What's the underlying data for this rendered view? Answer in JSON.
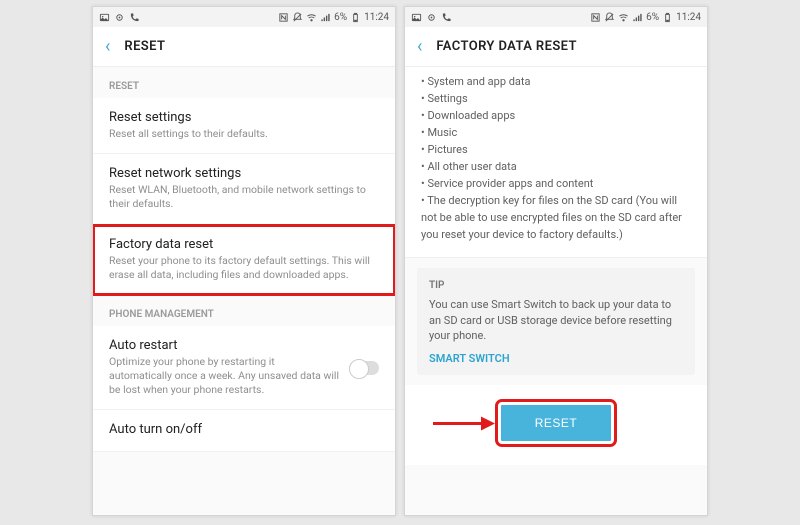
{
  "status": {
    "battery_pct": "6%",
    "time": "11:24"
  },
  "left": {
    "title": "RESET",
    "sections": {
      "reset_header": "RESET",
      "items": [
        {
          "primary": "Reset settings",
          "secondary": "Reset all settings to their defaults."
        },
        {
          "primary": "Reset network settings",
          "secondary": "Reset WLAN, Bluetooth, and mobile network settings to their defaults."
        },
        {
          "primary": "Factory data reset",
          "secondary": "Reset your phone to its factory default settings. This will erase all data, including files and downloaded apps."
        }
      ],
      "phone_mgmt_header": "PHONE MANAGEMENT",
      "phone_mgmt_items": [
        {
          "primary": "Auto restart",
          "secondary": "Optimize your phone by restarting it automatically once a week. Any unsaved data will be lost when your phone restarts."
        },
        {
          "primary": "Auto turn on/off",
          "secondary": ""
        }
      ]
    }
  },
  "right": {
    "title": "FACTORY DATA RESET",
    "bullets": [
      "System and app data",
      "Settings",
      "Downloaded apps",
      "Music",
      "Pictures",
      "All other user data",
      "Service provider apps and content",
      "The decryption key for files on the SD card (You will not be able to use encrypted files on the SD card after you reset your device to factory defaults.)"
    ],
    "tip": {
      "label": "TIP",
      "text": "You can use Smart Switch to back up your data to an SD card or USB storage device before resetting your phone.",
      "link": "SMART SWITCH"
    },
    "reset_button": "RESET"
  }
}
